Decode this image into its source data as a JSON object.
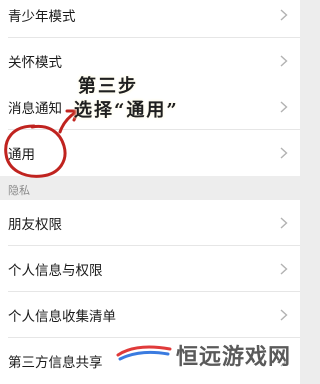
{
  "settings": {
    "group1": [
      {
        "label": "青少年模式"
      },
      {
        "label": "关怀模式"
      }
    ],
    "group2": [
      {
        "label": "消息通知"
      },
      {
        "label": "通用"
      }
    ],
    "section_privacy": "隐私",
    "group3": [
      {
        "label": "朋友权限"
      },
      {
        "label": "个人信息与权限"
      },
      {
        "label": "个人信息收集清单"
      },
      {
        "label": "第三方信息共享"
      }
    ]
  },
  "annotation": {
    "line1": "第三步",
    "line2": "选择“通用”",
    "color": "#c0231f"
  },
  "watermark": {
    "text": "恒远游戏网"
  },
  "colors": {
    "background": "#ededed",
    "row_background": "#ffffff",
    "chevron": "#b2b2b2"
  }
}
